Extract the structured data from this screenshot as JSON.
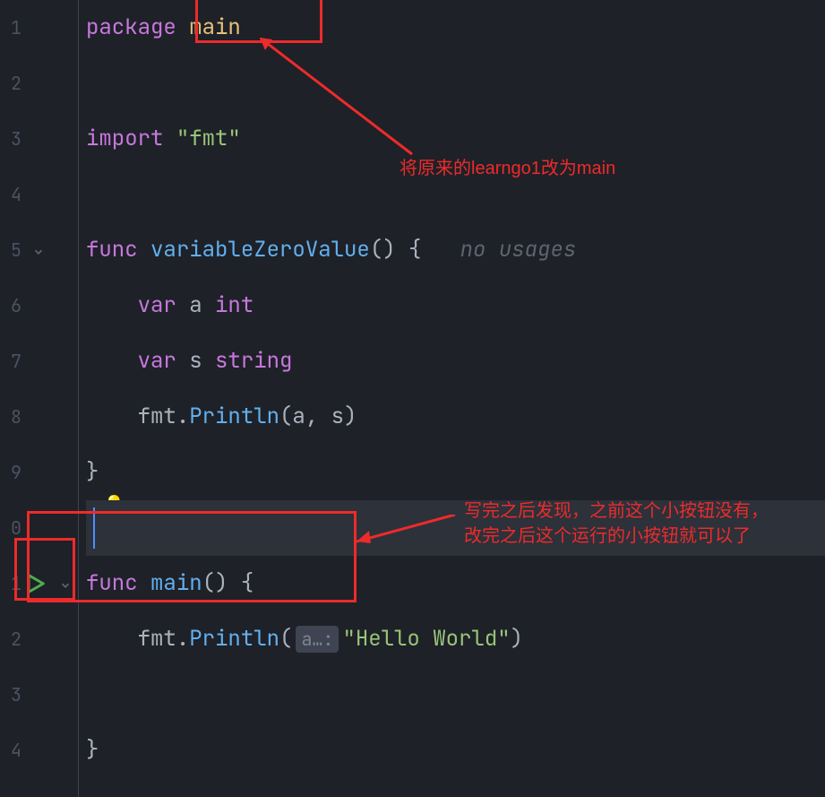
{
  "annotations": {
    "top_text": "将原来的learngo1改为main",
    "bottom_text_line1": "写完之后发现，之前这个小按钮没有，",
    "bottom_text_line2": "改完之后这个运行的小按钮就可以了"
  },
  "gutter": {
    "line_numbers": [
      "1",
      "2",
      "3",
      "4",
      "5",
      "6",
      "7",
      "8",
      "9",
      "0",
      "1",
      "2",
      "3",
      "4"
    ]
  },
  "code": {
    "l1": {
      "kw": "package",
      "ident": "main"
    },
    "l3": {
      "kw": "import",
      "str": "\"fmt\""
    },
    "l5": {
      "kw": "func",
      "name": "variableZeroValue",
      "parens": "()",
      "brace": "{",
      "hint": "no usages"
    },
    "l6": {
      "kw": "var",
      "ident": "a",
      "type": "int"
    },
    "l7": {
      "kw": "var",
      "ident": "s",
      "type": "string"
    },
    "l8": {
      "pkg": "fmt",
      "dot": ".",
      "fn": "Println",
      "args": "(a, s)"
    },
    "l9": {
      "brace": "}"
    },
    "l11": {
      "kw": "func",
      "name": "main",
      "parens": "()",
      "brace": "{"
    },
    "l12": {
      "pkg": "fmt",
      "dot": ".",
      "fn": "Println",
      "lparen": "(",
      "hint": "a…:",
      "str": "\"Hello World\"",
      "rparen": ")"
    },
    "l14": {
      "brace": "}"
    }
  }
}
